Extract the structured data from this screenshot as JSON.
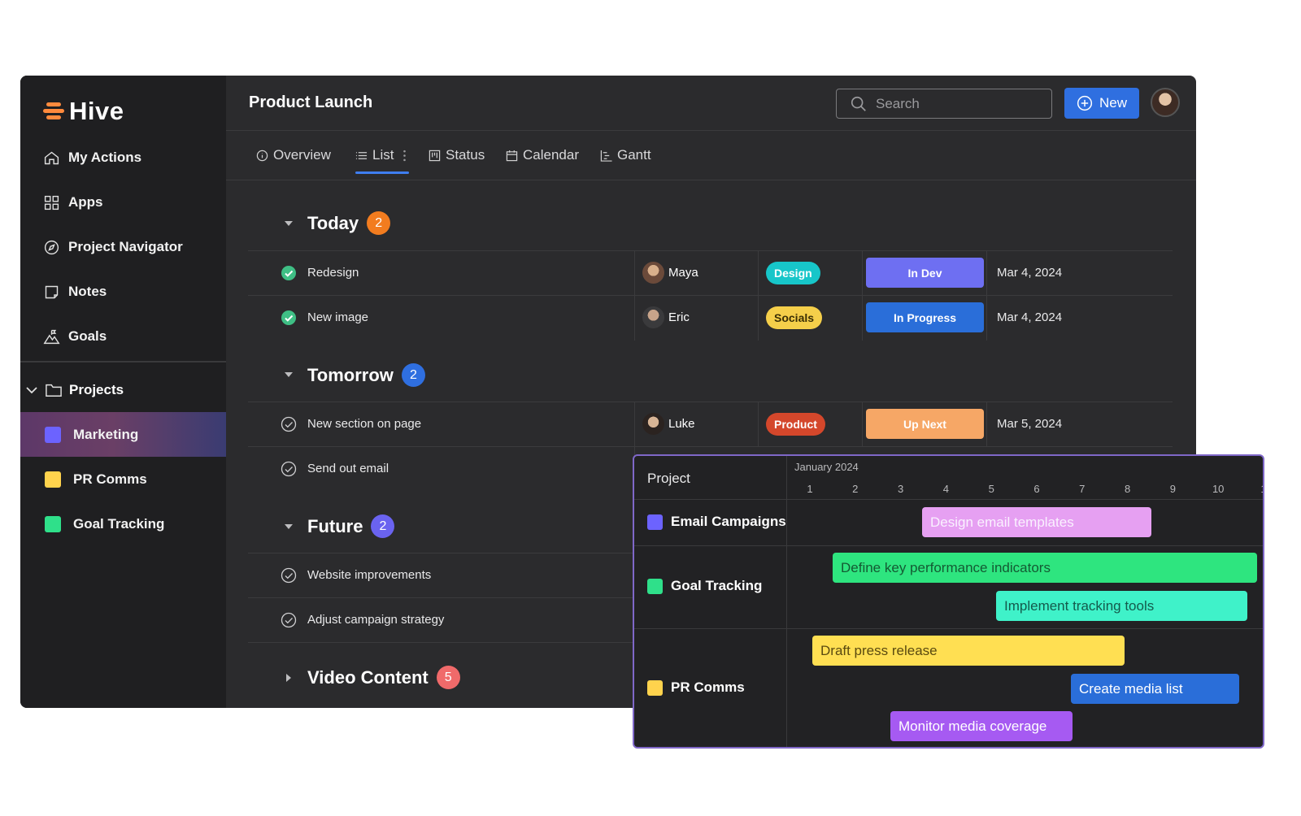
{
  "app": {
    "name": "Hive",
    "page_title": "Product Launch"
  },
  "sidebar": {
    "nav": [
      {
        "label": "My Actions",
        "icon": "home-icon"
      },
      {
        "label": "Apps",
        "icon": "grid-icon"
      },
      {
        "label": "Project Navigator",
        "icon": "compass-icon"
      },
      {
        "label": "Notes",
        "icon": "note-icon"
      },
      {
        "label": "Goals",
        "icon": "mountain-flag-icon"
      }
    ],
    "projects_label": "Projects",
    "projects": [
      {
        "label": "Marketing",
        "color": "#6c63ff",
        "active": true
      },
      {
        "label": "PR Comms",
        "color": "#ffd34d",
        "active": false
      },
      {
        "label": "Goal Tracking",
        "color": "#2fe08a",
        "active": false
      }
    ]
  },
  "topbar": {
    "search_placeholder": "Search",
    "new_label": "New"
  },
  "tabs": [
    {
      "label": "Overview",
      "icon": "info-icon"
    },
    {
      "label": "List",
      "icon": "list-icon",
      "active": true
    },
    {
      "label": "Status",
      "icon": "kanban-icon"
    },
    {
      "label": "Calendar",
      "icon": "calendar-icon"
    },
    {
      "label": "Gantt",
      "icon": "gantt-icon"
    }
  ],
  "groups": [
    {
      "title": "Today",
      "count": "2",
      "badge_color": "#f27c1f"
    },
    {
      "title": "Tomorrow",
      "count": "2",
      "badge_color": "#2f6fe0"
    },
    {
      "title": "Future",
      "count": "2",
      "badge_color": "#6a63f0"
    },
    {
      "title": "Video Content",
      "count": "5",
      "badge_color": "#f06a6a"
    }
  ],
  "tasks": [
    {
      "name": "Redesign",
      "done": true,
      "assignee": "Maya",
      "tag": "Design",
      "tag_color": "#17c6c9",
      "status": "In Dev",
      "status_color": "#6e6ff2",
      "date": "Mar 4, 2024"
    },
    {
      "name": "New image",
      "done": true,
      "assignee": "Eric",
      "tag": "Socials",
      "tag_color": "#f5cf4a",
      "status": "In Progress",
      "status_color": "#2a6ed9",
      "date": "Mar 4, 2024"
    },
    {
      "name": "New section on page",
      "done": false,
      "assignee": "Luke",
      "tag": "Product",
      "tag_color": "#d4472b",
      "status": "Up Next",
      "status_color": "#f6a766",
      "date": "Mar 5, 2024"
    },
    {
      "name": "Send out email",
      "done": false
    },
    {
      "name": "Website improvements",
      "done": false
    },
    {
      "name": "Adjust campaign strategy",
      "done": false
    }
  ],
  "gantt": {
    "project_header": "Project",
    "month": "January 2024",
    "days": [
      "1",
      "2",
      "3",
      "4",
      "5",
      "6",
      "7",
      "8",
      "9",
      "10",
      "1"
    ],
    "rows": [
      {
        "label": "Email Campaigns",
        "color": "#6c63ff"
      },
      {
        "label": "Goal Tracking",
        "color": "#2fe08a"
      },
      {
        "label": "PR Comms",
        "color": "#ffd34d"
      }
    ],
    "bars": [
      {
        "label": "Design email templates",
        "color": "#e6a0f2",
        "text_color": "#faf1ff"
      },
      {
        "label": "Define key performance indicators",
        "color": "#2ee57f",
        "text_color": "#145a33"
      },
      {
        "label": "Implement tracking tools",
        "color": "#3ff2c9",
        "text_color": "#145a4c"
      },
      {
        "label": "Draft press release",
        "color": "#ffdf52",
        "text_color": "#5a4a10"
      },
      {
        "label": "Create media list",
        "color": "#2a6ed9",
        "text_color": "#ffffff"
      },
      {
        "label": "Monitor media coverage",
        "color": "#a65af2",
        "text_color": "#ffffff"
      }
    ]
  }
}
